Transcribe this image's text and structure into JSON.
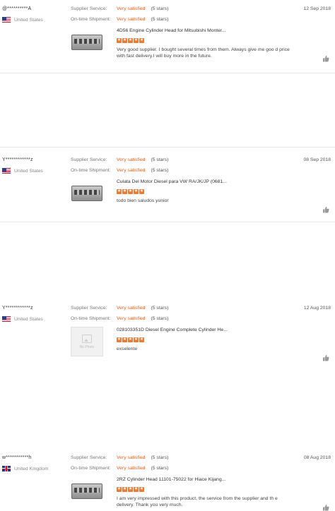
{
  "labels": {
    "supplier_service": "Supplier Service:",
    "ontime_shipment": "On-time Shipment:",
    "no_photo": "No Photo"
  },
  "reviews": [
    {
      "user": "@**********A",
      "country": "United States",
      "flag": "us",
      "supplier_service": "Very satisfied",
      "supplier_stars": "(5 stars)",
      "ontime": "Very satisfied",
      "ontime_stars": "(5 stars)",
      "date": "12 Sep 2018",
      "product": "4D56 Engine Cylinder Head for Mitsubishi Monter...",
      "rating": 5,
      "comment": "Very good supplier. I bought several times from them. Always give me goo d price with fast delivery.I will buy more in the future.",
      "image": "engine"
    },
    {
      "user": "Y************z",
      "country": "United States",
      "flag": "us",
      "supplier_service": "Very satisfied",
      "supplier_stars": "(5 stars)",
      "ontime": "Very satisfied",
      "ontime_stars": "(5 stars)",
      "date": "08 Sep 2018",
      "product": "Culata Del Motor Diesel para VW RA/JK/JP (0681...",
      "rating": 5,
      "comment": "todo bien saludos yunior",
      "image": "engine"
    },
    {
      "user": "Y************z",
      "country": "United States",
      "flag": "us",
      "supplier_service": "Very satisfied",
      "supplier_stars": "(5 stars)",
      "ontime": "Very satisfied",
      "ontime_stars": "(5 stars)",
      "date": "12 Aug 2018",
      "product": "028103351D Diesel Engine Complete Cylinder He...",
      "rating": 5,
      "comment": "exselente",
      "image": "nophoto"
    },
    {
      "user": "w***********h",
      "country": "United Kingdom",
      "flag": "uk",
      "supplier_service": "Very satisfied",
      "supplier_stars": "(5 stars)",
      "ontime": "Very satisfied",
      "ontime_stars": "(5 stars)",
      "date": "08 Aug 2018",
      "product": "2RZ Cylinder Head 11101-75022 for Hiace Kijang...",
      "rating": 5,
      "comment": "I am very impressed with this product, the service from the supplier and th e delivery. Thank you very much.",
      "image": "engine"
    }
  ],
  "colors": {
    "accent": "#e8601c",
    "star": "#f5782a"
  },
  "icons": {
    "star": "star-icon",
    "thumbs_up": "thumbs-up-icon",
    "flag": "flag-icon"
  }
}
